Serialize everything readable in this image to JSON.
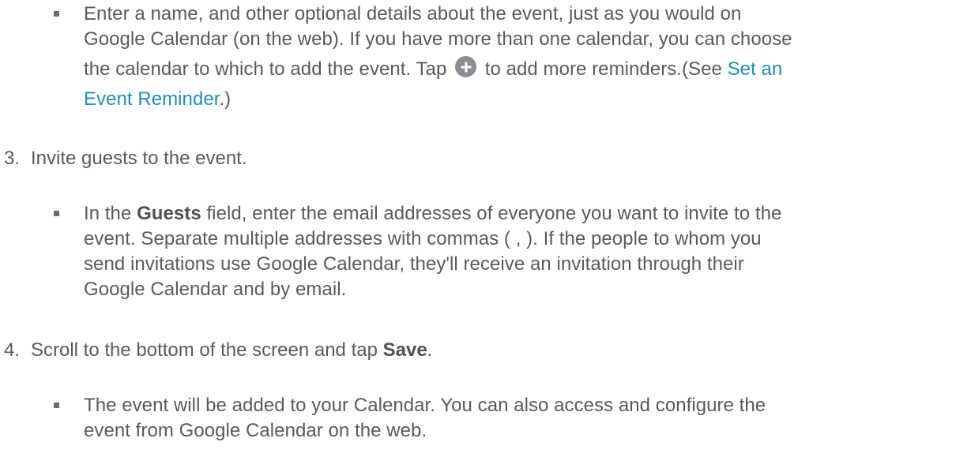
{
  "bullet1": {
    "line1": "Enter a name, and other optional details about the event, just as you would on",
    "line2": "Google Calendar (on the web). If you have more than one calendar, you can choose",
    "line3_before_icon": "the calendar to which to add the event. Tap",
    "icon": "plus-circle-icon",
    "line3_after_icon": "to add more reminders.(See",
    "link_part1": "Set an",
    "link_part2": "Event Reminder",
    "line4_after_link": ".)"
  },
  "step3": {
    "number": "3.",
    "text": "Invite guests to the event."
  },
  "bullet2": {
    "line1_before": "In the",
    "bold": "Guests",
    "line1_after": "field, enter the email addresses of everyone you want to invite to the",
    "line2": "event. Separate multiple addresses with commas ( , ). If the people to whom you",
    "line3": "send invitations use Google Calendar, they'll receive an invitation through their",
    "line4": "Google Calendar and by email."
  },
  "step4": {
    "number": "4.",
    "text_before": "Scroll to the bottom of the screen and tap",
    "bold": "Save",
    "text_after": "."
  },
  "bullet3": {
    "line1": "The event will be added to your Calendar. You can also access and configure the",
    "line2": "event from Google Calendar on the web."
  },
  "colors": {
    "text": "#5a5a5a",
    "link": "#1a90b8",
    "icon": "#8a8e94"
  }
}
